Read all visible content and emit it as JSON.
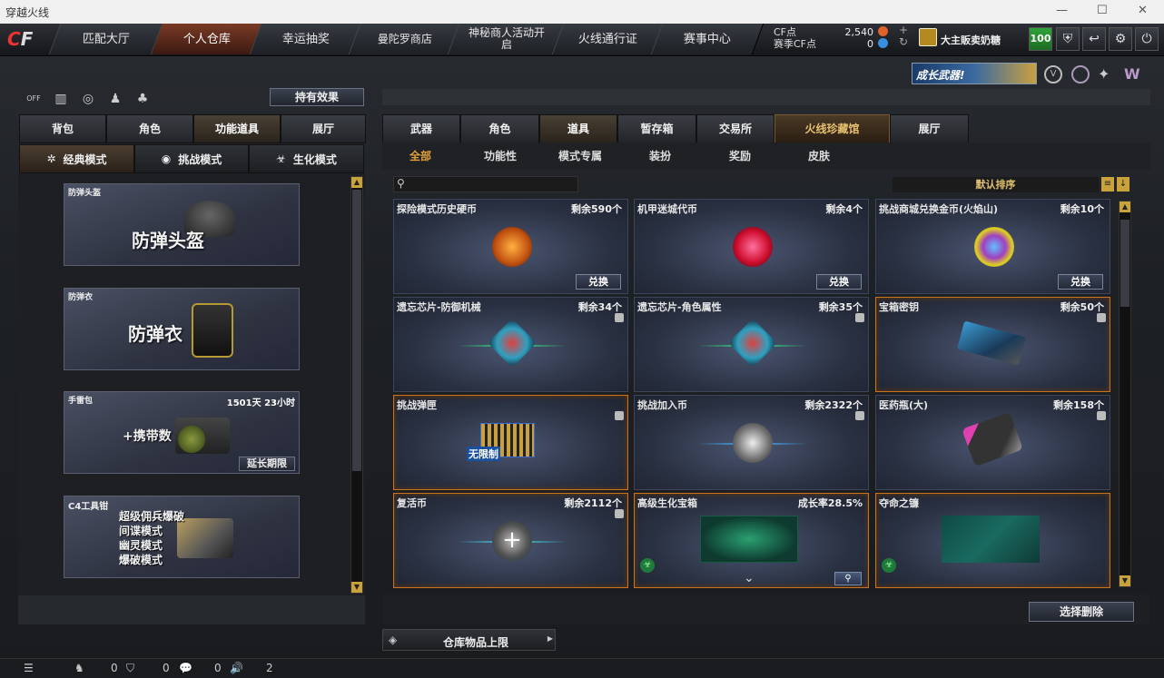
{
  "window": {
    "title": "穿越火线"
  },
  "nav": {
    "items": [
      "匹配大厅",
      "个人仓库",
      "幸运抽奖",
      "曼陀罗商店",
      "神秘商人活动开启",
      "火线通行证",
      "赛事中心"
    ]
  },
  "account": {
    "cf_label": "CF点",
    "cf_value": "2,540",
    "special_label": "赛季CF点",
    "special_value": "0",
    "username": "大主販卖奶糖",
    "level": "100"
  },
  "banner": {
    "text": "成长武器!"
  },
  "left": {
    "effects_button": "持有效果",
    "tabs": [
      "背包",
      "角色",
      "功能道具",
      "展厅"
    ],
    "modes": [
      "经典模式",
      "挑战模式",
      "生化模式"
    ],
    "cards": [
      {
        "caption": "防弹头盔",
        "title": "防弹头盔"
      },
      {
        "caption": "防弹衣",
        "title": "防弹衣"
      },
      {
        "caption": "手雷包",
        "title": "+携带数",
        "time": "1501天 23小时",
        "action": "延长期限"
      },
      {
        "caption": "C4工具钳",
        "lines": [
          "超级佣兵爆破",
          "间谍模式",
          "幽灵模式",
          "爆破模式"
        ]
      }
    ]
  },
  "right": {
    "tabs": [
      "武器",
      "角色",
      "道具",
      "暂存箱",
      "交易所",
      "火线珍藏馆",
      "展厅"
    ],
    "subtabs": [
      "全部",
      "功能性",
      "模式专属",
      "装扮",
      "奖励",
      "皮肤"
    ],
    "sort_label": "默认排序",
    "items": [
      {
        "name": "探险模式历史硬币",
        "qty": "剩余590个",
        "action": "兑换"
      },
      {
        "name": "机甲迷城代币",
        "qty": "剩余4个",
        "action": "兑换"
      },
      {
        "name": "挑战商城兑换金币(火焰山)",
        "qty": "剩余10个",
        "action": "兑换"
      },
      {
        "name": "遗忘芯片-防御机械",
        "qty": "剩余34个"
      },
      {
        "name": "遗忘芯片-角色属性",
        "qty": "剩余35个"
      },
      {
        "name": "宝箱密钥",
        "qty": "剩余50个"
      },
      {
        "name": "挑战弹匣",
        "qty": "",
        "art_text": "无限制"
      },
      {
        "name": "挑战加入币",
        "qty": "剩余2322个"
      },
      {
        "name": "医药瓶(大)",
        "qty": "剩余158个"
      },
      {
        "name": "复活币",
        "qty": "剩余2112个"
      },
      {
        "name": "高级生化宝箱",
        "qty": "成长率28.5%"
      },
      {
        "name": "夺命之镰",
        "qty": ""
      }
    ],
    "delete_button": "选择删除",
    "capacity_label": "仓库物品上限"
  },
  "status": {
    "v1": "0",
    "v2": "0",
    "v3": "0",
    "v4": "2"
  }
}
